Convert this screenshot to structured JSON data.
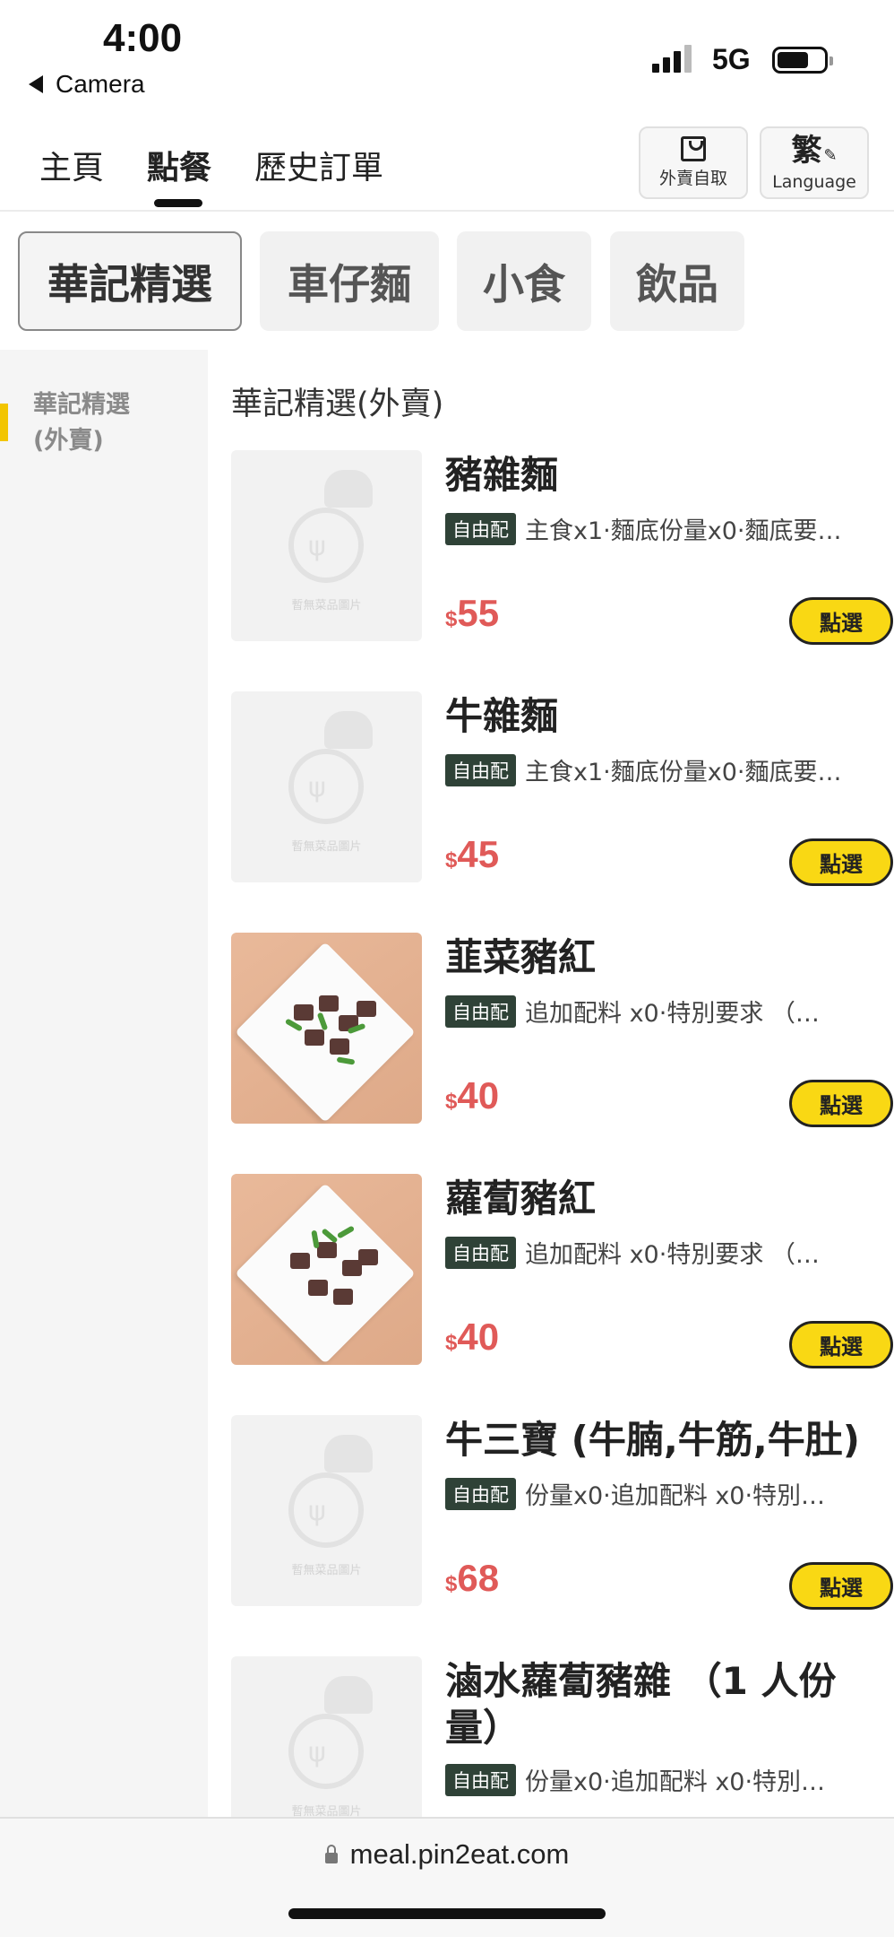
{
  "status_bar": {
    "time": "4:00",
    "back_label": "Camera",
    "network": "5G",
    "battery_level": 0.68
  },
  "top_nav": {
    "tabs": [
      {
        "label": "主頁",
        "active": false
      },
      {
        "label": "點餐",
        "active": true
      },
      {
        "label": "歷史訂單",
        "active": false
      }
    ],
    "takeout_label": "外賣自取",
    "language_char": "繁",
    "language_label": "Language"
  },
  "categories": [
    {
      "label": "華記精選",
      "active": true
    },
    {
      "label": "車仔麵",
      "active": false
    },
    {
      "label": "小食",
      "active": false
    },
    {
      "label": "飲品",
      "active": false
    }
  ],
  "sidebar": {
    "items": [
      {
        "line1": "華記精選",
        "line2": "(外賣)",
        "active": true
      }
    ]
  },
  "section_title": "華記精選(外賣)",
  "placeholder_text": "暫無菜品圖片",
  "items": [
    {
      "name": "豬雜麵",
      "tag": "自由配",
      "desc": "主食x1‧麵底份量x0‧麵底要…",
      "currency": "$",
      "price": "55",
      "button": "點選",
      "image": "placeholder"
    },
    {
      "name": "牛雜麵",
      "tag": "自由配",
      "desc": "主食x1‧麵底份量x0‧麵底要…",
      "currency": "$",
      "price": "45",
      "button": "點選",
      "image": "placeholder"
    },
    {
      "name": "韮菜豬紅",
      "tag": "自由配",
      "desc": "追加配料 x0‧特別要求 （…",
      "currency": "$",
      "price": "40",
      "button": "點選",
      "image": "photo"
    },
    {
      "name": "蘿蔔豬紅",
      "tag": "自由配",
      "desc": "追加配料 x0‧特別要求 （…",
      "currency": "$",
      "price": "40",
      "button": "點選",
      "image": "photo"
    },
    {
      "name": "牛三寶 (牛腩,牛筋,牛肚)",
      "tag": "自由配",
      "desc": "份量x0‧追加配料 x0‧特別…",
      "currency": "$",
      "price": "68",
      "button": "點選",
      "image": "placeholder"
    },
    {
      "name": "滷水蘿蔔豬雜 （1 人份量）",
      "name_line1": "滷水蘿蔔豬雜 （1 人份",
      "name_line2": "量）",
      "tag": "自由配",
      "desc": "份量x0‧追加配料 x0‧特別…",
      "image": "placeholder"
    }
  ],
  "url_bar": {
    "url": "meal.pin2eat.com"
  },
  "colors": {
    "accent_yellow": "#f9d814",
    "price_red": "#e05a58",
    "tag_green": "#2f4237"
  }
}
